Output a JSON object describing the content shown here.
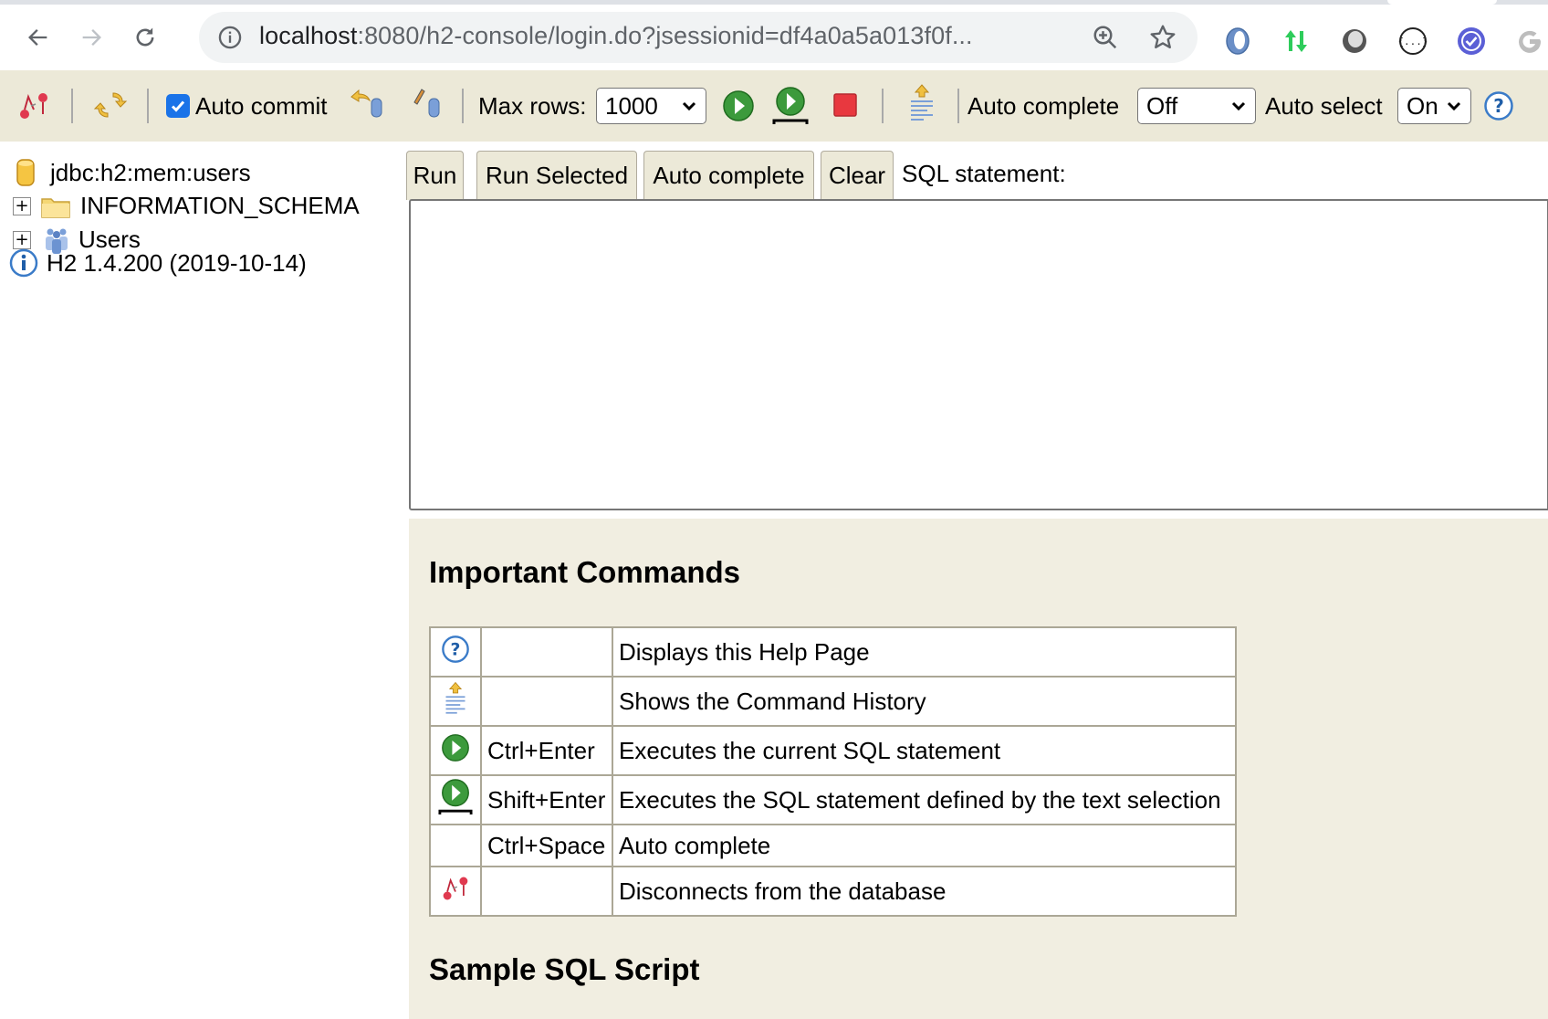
{
  "browser": {
    "url_host": "localhost",
    "url_rest": ":8080/h2-console/login.do?jsessionid=df4a0a5a013f0f...",
    "nav": {
      "back_icon": "arrow-left-icon",
      "forward_icon": "arrow-right-icon",
      "reload_icon": "reload-icon"
    },
    "extensions": [
      "jsonviewer-extension-icon",
      "updown-arrows-extension-icon",
      "circle-extension-icon",
      "json-braces-extension-icon",
      "check-badge-extension-icon",
      "google-extension-icon"
    ]
  },
  "toolbar": {
    "auto_commit_label": "Auto commit",
    "auto_commit_checked": true,
    "max_rows_label": "Max rows:",
    "max_rows_value": "1000",
    "auto_complete_label": "Auto complete",
    "auto_complete_value": "Off",
    "auto_select_label": "Auto select",
    "auto_select_value": "On"
  },
  "tree": {
    "connection": "jdbc:h2:mem:users",
    "nodes": [
      {
        "label": "INFORMATION_SCHEMA",
        "icon": "folder-icon",
        "expandable": true
      },
      {
        "label": "Users",
        "icon": "users-icon",
        "expandable": true
      }
    ],
    "version": "H2 1.4.200 (2019-10-14)"
  },
  "editor": {
    "buttons": [
      "Run",
      "Run Selected",
      "Auto complete",
      "Clear"
    ],
    "sql_label": "SQL statement:",
    "sql_value": ""
  },
  "help": {
    "important_title": "Important Commands",
    "commands": [
      {
        "icon": "help-icon",
        "key": "",
        "description": "Displays this Help Page"
      },
      {
        "icon": "history-icon",
        "key": "",
        "description": "Shows the Command History"
      },
      {
        "icon": "run-icon",
        "key": "Ctrl+Enter",
        "description": "Executes the current SQL statement"
      },
      {
        "icon": "run-selected-icon",
        "key": "Shift+Enter",
        "description": "Executes the SQL statement defined by the text selection"
      },
      {
        "icon": "",
        "key": "Ctrl+Space",
        "description": "Auto complete"
      },
      {
        "icon": "disconnect-icon",
        "key": "",
        "description": "Disconnects from the database"
      }
    ],
    "sample_title": "Sample SQL Script"
  }
}
